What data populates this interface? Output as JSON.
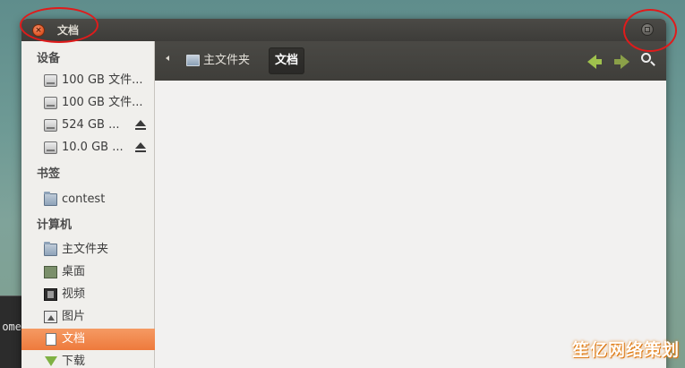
{
  "window": {
    "title": "文档"
  },
  "sidebar": {
    "devices_header": "设备",
    "devices": [
      {
        "label": "100 GB 文件...",
        "icon": "drive-icon",
        "ejectable": false
      },
      {
        "label": "100 GB 文件...",
        "icon": "drive-icon",
        "ejectable": false
      },
      {
        "label": "524 GB ...",
        "icon": "drive-icon",
        "ejectable": true
      },
      {
        "label": "10.0 GB ...",
        "icon": "drive-icon",
        "ejectable": true
      }
    ],
    "bookmarks_header": "书签",
    "bookmarks": [
      {
        "label": "contest",
        "icon": "folder-icon"
      }
    ],
    "computer_header": "计算机",
    "computer": [
      {
        "label": "主文件夹",
        "icon": "home-folder-icon"
      },
      {
        "label": "桌面",
        "icon": "desktop-icon"
      },
      {
        "label": "视频",
        "icon": "video-icon"
      },
      {
        "label": "图片",
        "icon": "picture-icon"
      },
      {
        "label": "文档",
        "icon": "document-icon",
        "selected": true
      },
      {
        "label": "下载",
        "icon": "download-icon"
      }
    ]
  },
  "toolbar": {
    "breadcrumb_home": "主文件夹",
    "breadcrumb_current": "文档"
  },
  "desktop": {
    "terminal_fragment": "ome",
    "watermark": "笙亿网络策划"
  },
  "colors": {
    "accent_selected": "#ee7a3c",
    "annotation": "#e01b1b",
    "nav_arrow": "#9fc14d"
  }
}
